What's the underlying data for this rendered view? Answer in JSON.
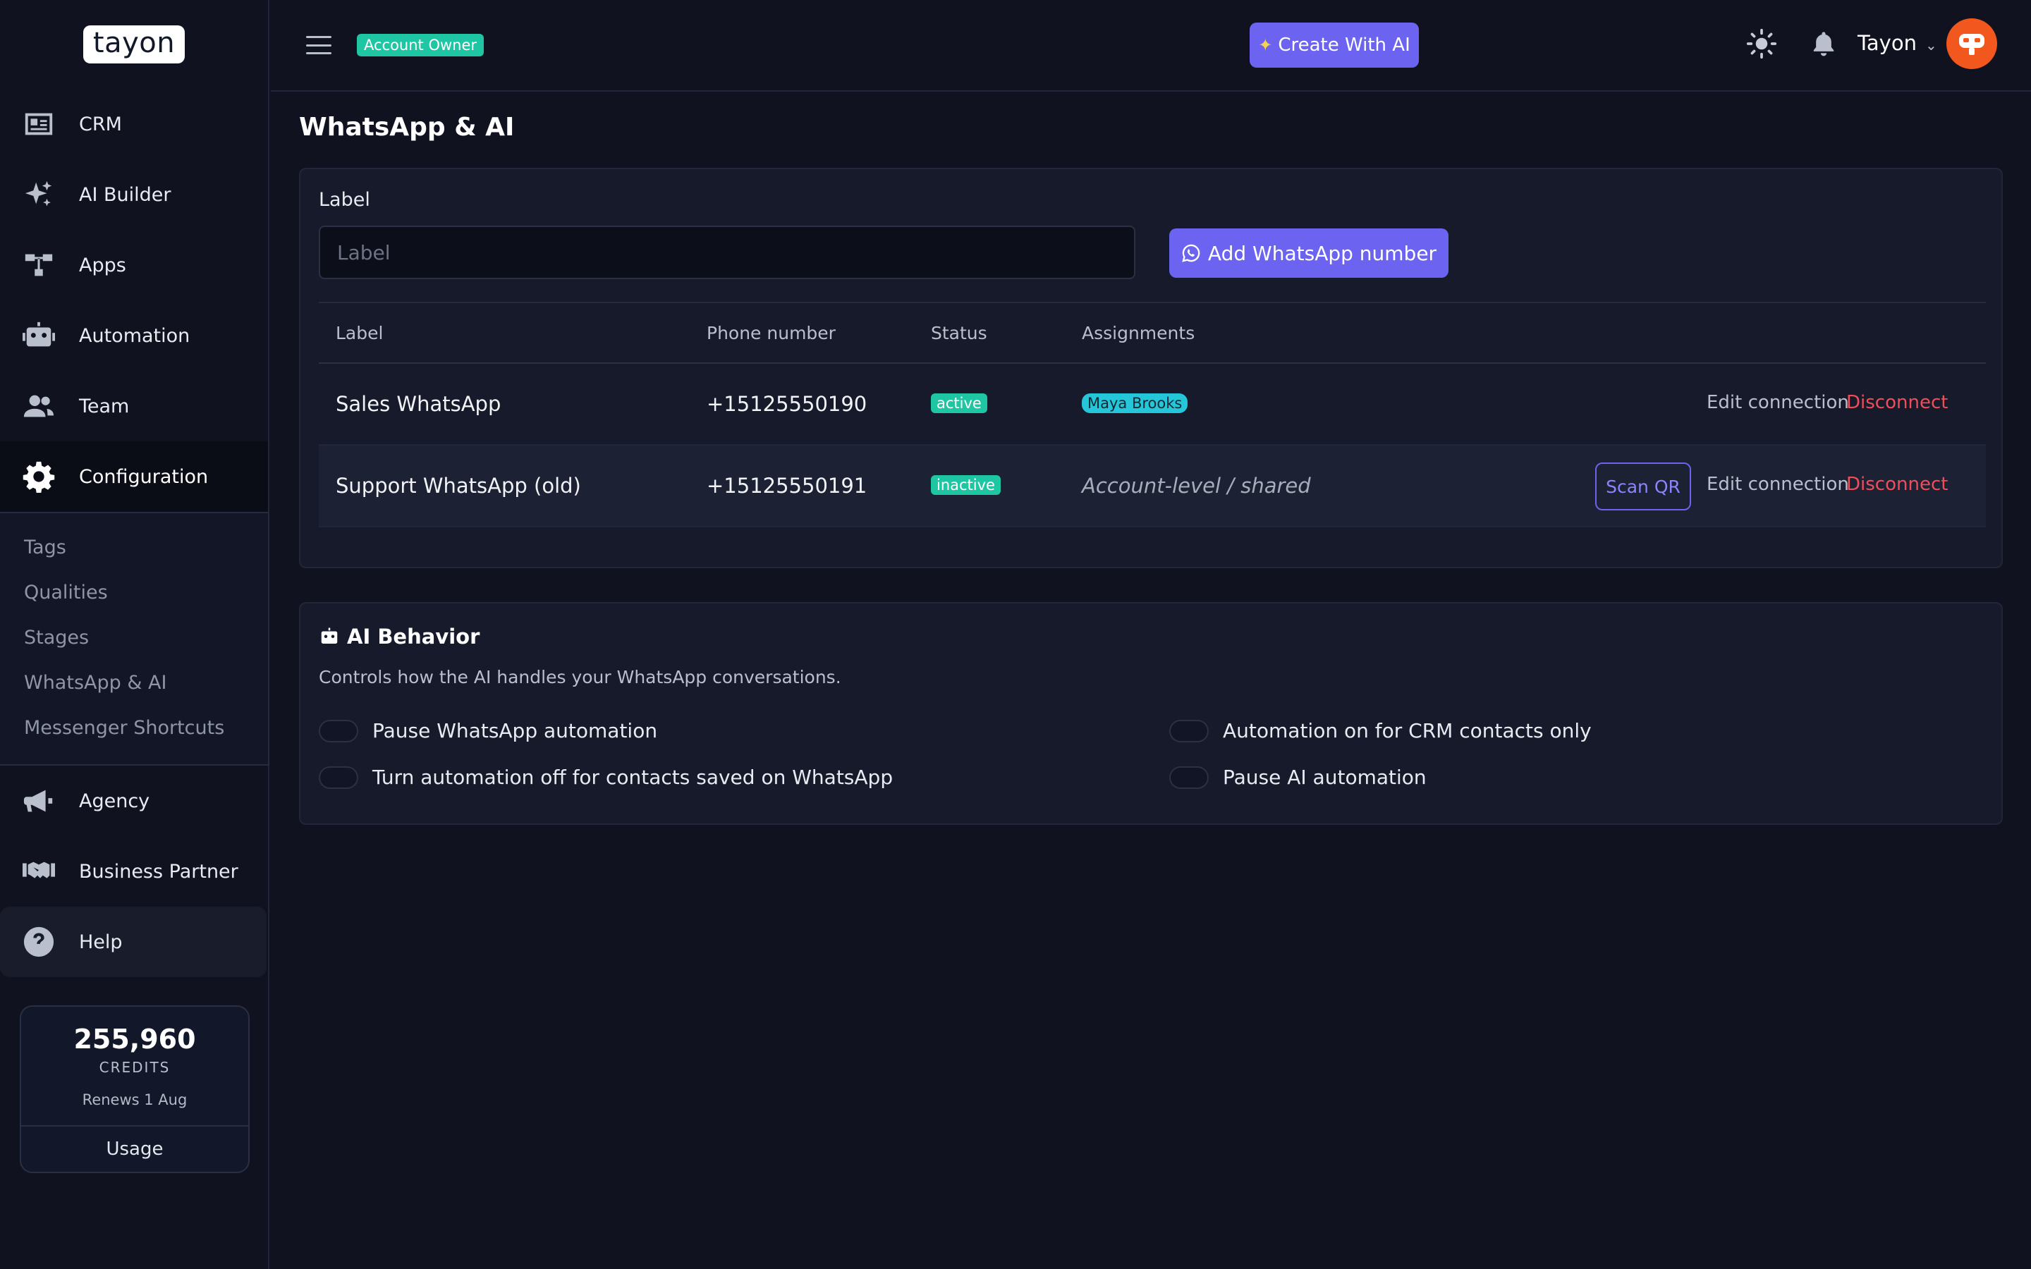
{
  "brand": {
    "logo_text": "tayon"
  },
  "sidebar": {
    "items": [
      {
        "label": "CRM",
        "icon": "id-card-icon"
      },
      {
        "label": "AI Builder",
        "icon": "sparkles-icon"
      },
      {
        "label": "Apps",
        "icon": "sitemap-icon"
      },
      {
        "label": "Automation",
        "icon": "robot-icon"
      },
      {
        "label": "Team",
        "icon": "users-icon"
      },
      {
        "label": "Configuration",
        "icon": "gear-icon"
      }
    ],
    "submenu": [
      "Tags",
      "Qualities",
      "Stages",
      "WhatsApp & AI",
      "Messenger Shortcuts"
    ],
    "items_after": [
      {
        "label": "Agency",
        "icon": "megaphone-icon"
      },
      {
        "label": "Business Partner",
        "icon": "handshake-icon"
      },
      {
        "label": "Help",
        "icon": "question-circle-icon"
      }
    ],
    "credits": {
      "amount": "255,960",
      "label": "CREDITS",
      "renews": "Renews 1 Aug",
      "usage_label": "Usage"
    }
  },
  "header": {
    "role_badge": "Account Owner",
    "create_button": "Create With AI",
    "user_name": "Tayon"
  },
  "page": {
    "title": "WhatsApp & AI"
  },
  "whatsapp": {
    "label_field": {
      "label": "Label",
      "placeholder": "Label",
      "value": ""
    },
    "add_button": "Add WhatsApp number",
    "columns": [
      "Label",
      "Phone number",
      "Status",
      "Assignments"
    ],
    "rows": [
      {
        "label": "Sales WhatsApp",
        "phone": "+15125550190",
        "status": "active",
        "assignment": "Maya Brooks",
        "assignment_type": "person",
        "scan": "",
        "edit": "Edit connection",
        "disconnect": "Disconnect"
      },
      {
        "label": "Support WhatsApp (old)",
        "phone": "+15125550191",
        "status": "inactive",
        "assignment": "Account-level / shared",
        "assignment_type": "shared",
        "scan": "Scan QR",
        "edit": "Edit connection",
        "disconnect": "Disconnect"
      }
    ]
  },
  "ai_behavior": {
    "title": "AI Behavior",
    "description": "Controls how the AI handles your WhatsApp conversations.",
    "toggles": [
      {
        "label": "Pause WhatsApp automation",
        "on": false
      },
      {
        "label": "Automation on for CRM contacts only",
        "on": false
      },
      {
        "label": "Turn automation off for contacts saved on WhatsApp",
        "on": false
      },
      {
        "label": "Pause AI automation",
        "on": false
      }
    ]
  },
  "colors": {
    "accent": "#6c63f0",
    "status_green": "#1fc6a3",
    "danger": "#f04d5b",
    "avatar": "#f2571d"
  }
}
